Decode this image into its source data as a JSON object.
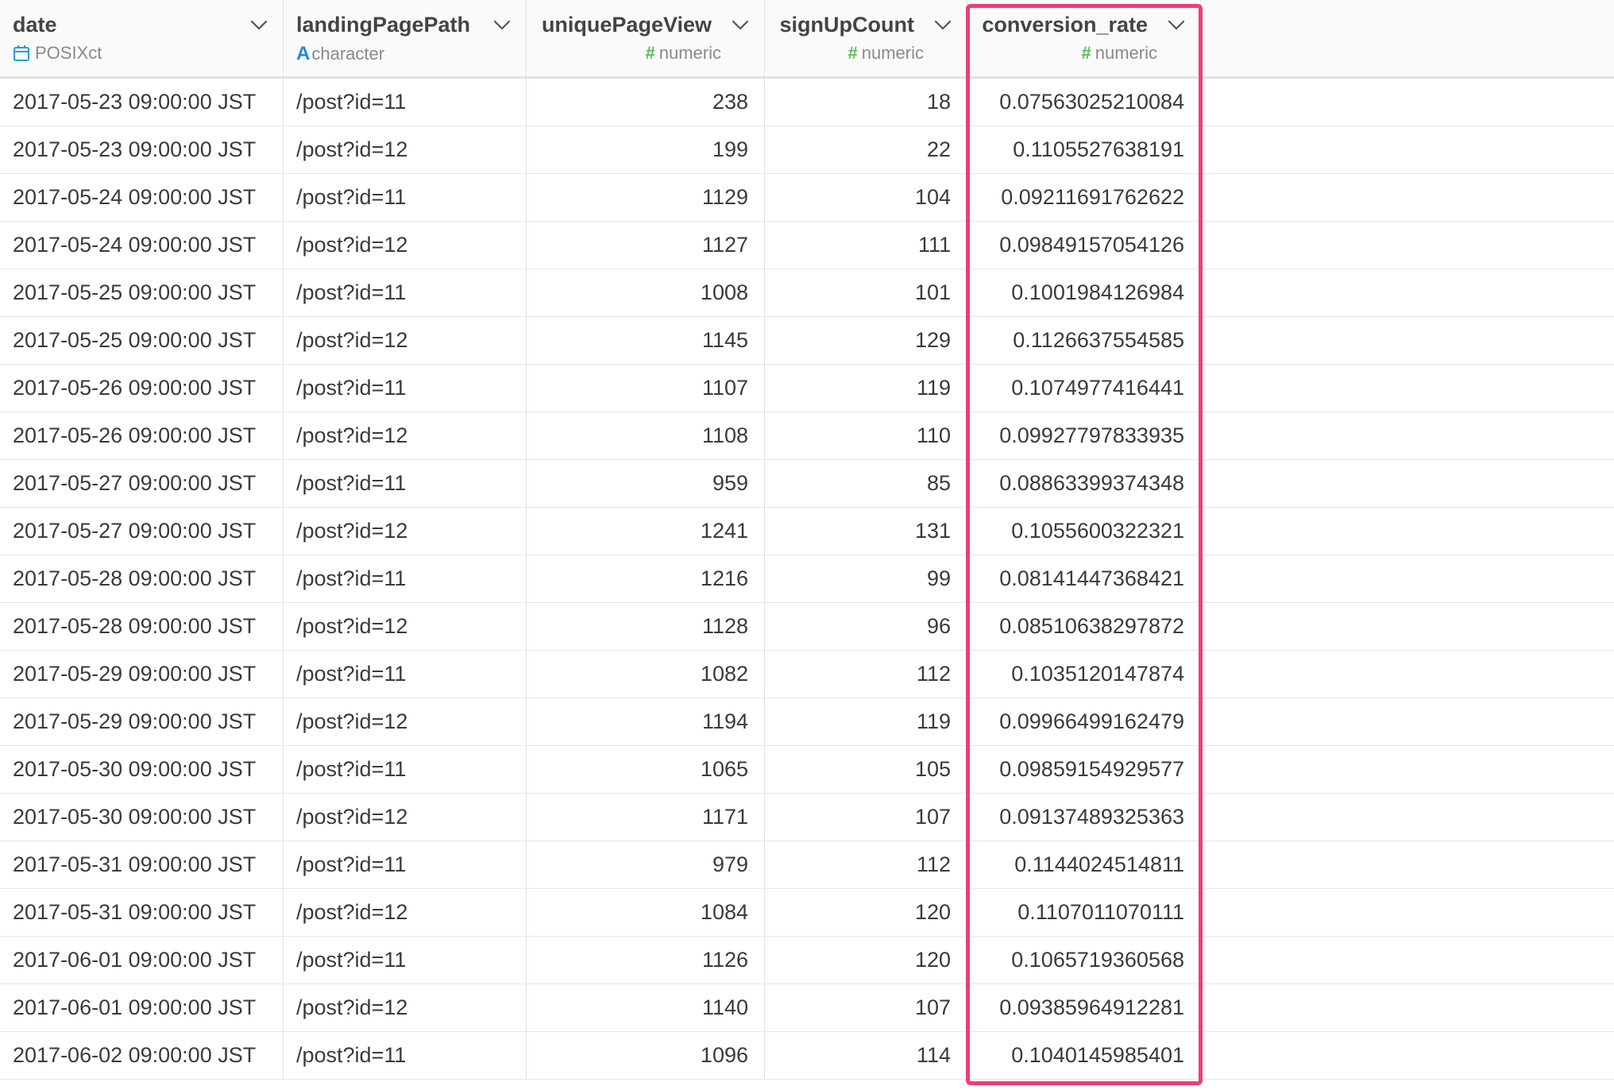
{
  "columns": [
    {
      "name": "date",
      "type": "POSIXct",
      "type_icon": "calendar-icon"
    },
    {
      "name": "landingPagePath",
      "type": "character",
      "type_icon": "A"
    },
    {
      "name": "uniquePageView",
      "type": "numeric",
      "type_icon": "#"
    },
    {
      "name": "signUpCount",
      "type": "numeric",
      "type_icon": "#"
    },
    {
      "name": "conversion_rate",
      "type": "numeric",
      "type_icon": "#"
    }
  ],
  "colors": {
    "highlight": "#ee3d79",
    "numeric_icon": "#5cb85c",
    "character_icon": "#1f8ad6",
    "date_icon": "#2a9ad8"
  },
  "highlighted_column": "conversion_rate",
  "rows": [
    [
      "2017-05-23 09:00:00 JST",
      "/post?id=11",
      "238",
      "18",
      "0.07563025210084"
    ],
    [
      "2017-05-23 09:00:00 JST",
      "/post?id=12",
      "199",
      "22",
      "0.1105527638191"
    ],
    [
      "2017-05-24 09:00:00 JST",
      "/post?id=11",
      "1129",
      "104",
      "0.09211691762622"
    ],
    [
      "2017-05-24 09:00:00 JST",
      "/post?id=12",
      "1127",
      "111",
      "0.09849157054126"
    ],
    [
      "2017-05-25 09:00:00 JST",
      "/post?id=11",
      "1008",
      "101",
      "0.1001984126984"
    ],
    [
      "2017-05-25 09:00:00 JST",
      "/post?id=12",
      "1145",
      "129",
      "0.1126637554585"
    ],
    [
      "2017-05-26 09:00:00 JST",
      "/post?id=11",
      "1107",
      "119",
      "0.1074977416441"
    ],
    [
      "2017-05-26 09:00:00 JST",
      "/post?id=12",
      "1108",
      "110",
      "0.09927797833935"
    ],
    [
      "2017-05-27 09:00:00 JST",
      "/post?id=11",
      "959",
      "85",
      "0.08863399374348"
    ],
    [
      "2017-05-27 09:00:00 JST",
      "/post?id=12",
      "1241",
      "131",
      "0.1055600322321"
    ],
    [
      "2017-05-28 09:00:00 JST",
      "/post?id=11",
      "1216",
      "99",
      "0.08141447368421"
    ],
    [
      "2017-05-28 09:00:00 JST",
      "/post?id=12",
      "1128",
      "96",
      "0.08510638297872"
    ],
    [
      "2017-05-29 09:00:00 JST",
      "/post?id=11",
      "1082",
      "112",
      "0.1035120147874"
    ],
    [
      "2017-05-29 09:00:00 JST",
      "/post?id=12",
      "1194",
      "119",
      "0.09966499162479"
    ],
    [
      "2017-05-30 09:00:00 JST",
      "/post?id=11",
      "1065",
      "105",
      "0.09859154929577"
    ],
    [
      "2017-05-30 09:00:00 JST",
      "/post?id=12",
      "1171",
      "107",
      "0.09137489325363"
    ],
    [
      "2017-05-31 09:00:00 JST",
      "/post?id=11",
      "979",
      "112",
      "0.1144024514811"
    ],
    [
      "2017-05-31 09:00:00 JST",
      "/post?id=12",
      "1084",
      "120",
      "0.1107011070111"
    ],
    [
      "2017-06-01 09:00:00 JST",
      "/post?id=11",
      "1126",
      "120",
      "0.1065719360568"
    ],
    [
      "2017-06-01 09:00:00 JST",
      "/post?id=12",
      "1140",
      "107",
      "0.09385964912281"
    ],
    [
      "2017-06-02 09:00:00 JST",
      "/post?id=11",
      "1096",
      "114",
      "0.1040145985401"
    ]
  ]
}
